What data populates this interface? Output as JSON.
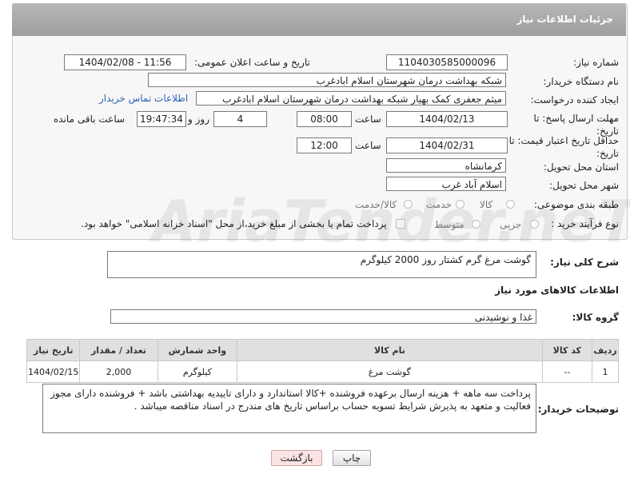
{
  "panel": {
    "title": "جزئیات اطلاعات نیاز"
  },
  "form": {
    "need_number_label": "شماره نیاز:",
    "need_number": "1104030585000096",
    "announce_label": "تاریخ و ساعت اعلان عمومی:",
    "announce_value": "1404/02/08 - 11:56",
    "buyer_org_label": "نام دستگاه خریدار:",
    "buyer_org": "شبکه بهداشت درمان شهرستان اسلام ابادغرب",
    "creator_label": "ایجاد کننده درخواست:",
    "creator": "میثم جعفری کمک بهیار شبکه بهداشت درمان شهرستان اسلام ابادغرب",
    "contact_link": "اطلاعات تماس خریدار",
    "deadline_label": "مهلت ارسال پاسخ: تا تاریخ:",
    "deadline_date": "1404/02/13",
    "time_label": "ساعت",
    "deadline_time": "08:00",
    "days_value": "4",
    "days_label": "روز و",
    "remaining_time": "19:47:34",
    "remaining_label": "ساعت باقی مانده",
    "min_validity_label": "حداقل تاریخ اعتبار قیمت: تا تاریخ:",
    "validity_date": "1404/02/31",
    "validity_time_label": "ساعت",
    "validity_time": "12:00",
    "province_label": "استان محل تحویل:",
    "province": "کرمانشاه",
    "city_label": "شهر محل تحویل:",
    "city": "اسلام آباد غرب",
    "category_label": "طبقه بندی موضوعی:",
    "category_options": [
      "کالا",
      "خدمت",
      "کالا/خدمت"
    ],
    "process_label": "نوع فرآیند خرید :",
    "process_options": [
      "جزیی",
      "متوسط"
    ],
    "payment_note": "پرداخت تمام یا بخشی از مبلغ خرید،از محل \"اسناد خزانه اسلامی\" خواهد بود."
  },
  "description": {
    "label": "شرح کلی نیاز:",
    "text": "گوشت مرغ گرم کشتار روز 2000 کیلوگرم"
  },
  "goods": {
    "section_title": "اطلاعات کالاهای مورد نیاز",
    "group_label": "گروه کالا:",
    "group_value": "غذا و نوشیدنی",
    "columns": [
      "ردیف",
      "کد کالا",
      "نام کالا",
      "واحد شمارش",
      "تعداد / مقدار",
      "تاریخ نیاز"
    ],
    "rows": [
      [
        "1",
        "--",
        "گوشت مرغ",
        "کیلوگرم",
        "2,000",
        "1404/02/15"
      ]
    ]
  },
  "buyer_notes": {
    "label": "توضیحات خریدار:",
    "text": "پرداخت سه ماهه + هزینه ارسال برعهده فروشنده +کالا استاندارد و دارای تاییدیه بهداشتی باشد + فروشنده دارای مجوز فعالیت و متعهد به پذیرش  شرایط تسویه حساب براساس تاریخ های مندرج در اسناد مناقصه میباشد ."
  },
  "buttons": {
    "print": "چاپ",
    "back": "بازگشت"
  },
  "watermark": "AriaTender.neT"
}
